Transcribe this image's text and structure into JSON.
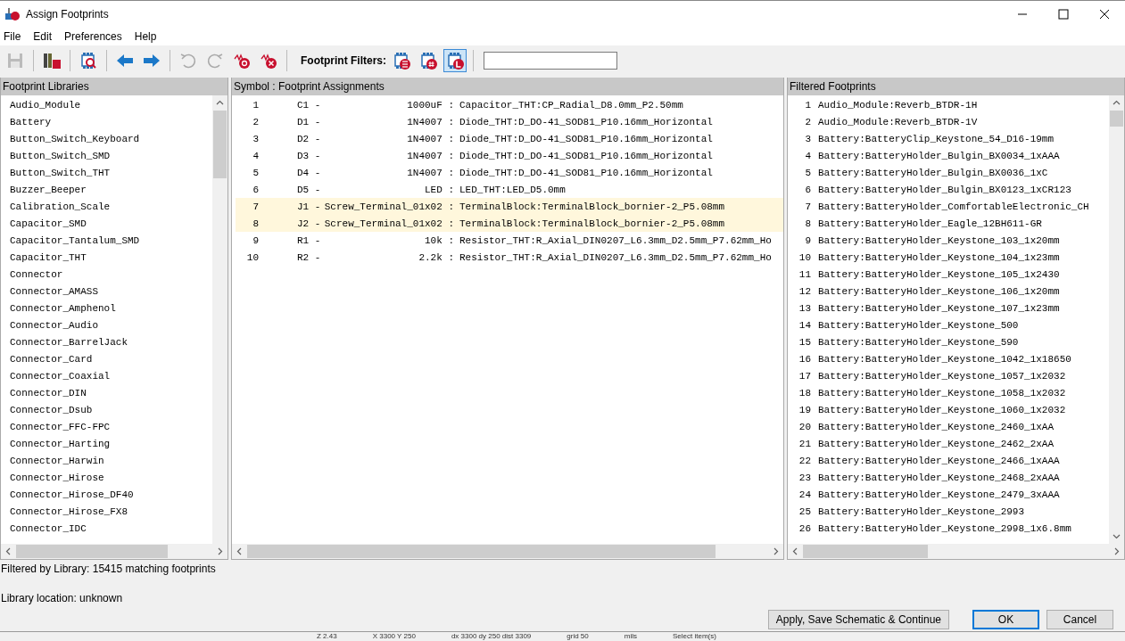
{
  "window": {
    "title": "Assign Footprints"
  },
  "menu": [
    "File",
    "Edit",
    "Preferences",
    "Help"
  ],
  "toolbar": {
    "filters_label": "Footprint Filters:",
    "filters": [
      {
        "kind": "list",
        "selected": false
      },
      {
        "kind": "pin",
        "selected": false
      },
      {
        "kind": "library",
        "selected": true
      }
    ]
  },
  "libraries": {
    "title": "Footprint Libraries",
    "items": [
      "Audio_Module",
      "Battery",
      "Button_Switch_Keyboard",
      "Button_Switch_SMD",
      "Button_Switch_THT",
      "Buzzer_Beeper",
      "Calibration_Scale",
      "Capacitor_SMD",
      "Capacitor_Tantalum_SMD",
      "Capacitor_THT",
      "Connector",
      "Connector_AMASS",
      "Connector_Amphenol",
      "Connector_Audio",
      "Connector_BarrelJack",
      "Connector_Card",
      "Connector_Coaxial",
      "Connector_DIN",
      "Connector_Dsub",
      "Connector_FFC-FPC",
      "Connector_Harting",
      "Connector_Harwin",
      "Connector_Hirose",
      "Connector_Hirose_DF40",
      "Connector_Hirose_FX8",
      "Connector_IDC"
    ]
  },
  "assignments": {
    "title": "Symbol : Footprint Assignments",
    "rows": [
      {
        "index": "1",
        "reference": "C1 -",
        "value": "1000uF :",
        "footprint": "Capacitor_THT:CP_Radial_D8.0mm_P2.50mm",
        "highlighted": false
      },
      {
        "index": "2",
        "reference": "D1 -",
        "value": "1N4007 :",
        "footprint": "Diode_THT:D_DO-41_SOD81_P10.16mm_Horizontal",
        "highlighted": false
      },
      {
        "index": "3",
        "reference": "D2 -",
        "value": "1N4007 :",
        "footprint": "Diode_THT:D_DO-41_SOD81_P10.16mm_Horizontal",
        "highlighted": false
      },
      {
        "index": "4",
        "reference": "D3 -",
        "value": "1N4007 :",
        "footprint": "Diode_THT:D_DO-41_SOD81_P10.16mm_Horizontal",
        "highlighted": false
      },
      {
        "index": "5",
        "reference": "D4 -",
        "value": "1N4007 :",
        "footprint": "Diode_THT:D_DO-41_SOD81_P10.16mm_Horizontal",
        "highlighted": false
      },
      {
        "index": "6",
        "reference": "D5 -",
        "value": "LED :",
        "footprint": "LED_THT:LED_D5.0mm",
        "highlighted": false
      },
      {
        "index": "7",
        "reference": "J1 -",
        "value": "Screw_Terminal_01x02 :",
        "footprint": "TerminalBlock:TerminalBlock_bornier-2_P5.08mm",
        "highlighted": true
      },
      {
        "index": "8",
        "reference": "J2 -",
        "value": "Screw_Terminal_01x02 :",
        "footprint": "TerminalBlock:TerminalBlock_bornier-2_P5.08mm",
        "highlighted": true
      },
      {
        "index": "9",
        "reference": "R1 -",
        "value": "10k :",
        "footprint": "Resistor_THT:R_Axial_DIN0207_L6.3mm_D2.5mm_P7.62mm_Ho",
        "highlighted": false
      },
      {
        "index": "10",
        "reference": "R2 -",
        "value": "2.2k :",
        "footprint": "Resistor_THT:R_Axial_DIN0207_L6.3mm_D2.5mm_P7.62mm_Ho",
        "highlighted": false
      }
    ]
  },
  "filtered": {
    "title": "Filtered Footprints",
    "items": [
      {
        "index": "1",
        "name": "Audio_Module:Reverb_BTDR-1H"
      },
      {
        "index": "2",
        "name": "Audio_Module:Reverb_BTDR-1V"
      },
      {
        "index": "3",
        "name": "Battery:BatteryClip_Keystone_54_D16-19mm"
      },
      {
        "index": "4",
        "name": "Battery:BatteryHolder_Bulgin_BX0034_1xAAA"
      },
      {
        "index": "5",
        "name": "Battery:BatteryHolder_Bulgin_BX0036_1xC"
      },
      {
        "index": "6",
        "name": "Battery:BatteryHolder_Bulgin_BX0123_1xCR123"
      },
      {
        "index": "7",
        "name": "Battery:BatteryHolder_ComfortableElectronic_CH"
      },
      {
        "index": "8",
        "name": "Battery:BatteryHolder_Eagle_12BH611-GR"
      },
      {
        "index": "9",
        "name": "Battery:BatteryHolder_Keystone_103_1x20mm"
      },
      {
        "index": "10",
        "name": "Battery:BatteryHolder_Keystone_104_1x23mm"
      },
      {
        "index": "11",
        "name": "Battery:BatteryHolder_Keystone_105_1x2430"
      },
      {
        "index": "12",
        "name": "Battery:BatteryHolder_Keystone_106_1x20mm"
      },
      {
        "index": "13",
        "name": "Battery:BatteryHolder_Keystone_107_1x23mm"
      },
      {
        "index": "14",
        "name": "Battery:BatteryHolder_Keystone_500"
      },
      {
        "index": "15",
        "name": "Battery:BatteryHolder_Keystone_590"
      },
      {
        "index": "16",
        "name": "Battery:BatteryHolder_Keystone_1042_1x18650"
      },
      {
        "index": "17",
        "name": "Battery:BatteryHolder_Keystone_1057_1x2032"
      },
      {
        "index": "18",
        "name": "Battery:BatteryHolder_Keystone_1058_1x2032"
      },
      {
        "index": "19",
        "name": "Battery:BatteryHolder_Keystone_1060_1x2032"
      },
      {
        "index": "20",
        "name": "Battery:BatteryHolder_Keystone_2460_1xAA"
      },
      {
        "index": "21",
        "name": "Battery:BatteryHolder_Keystone_2462_2xAA"
      },
      {
        "index": "22",
        "name": "Battery:BatteryHolder_Keystone_2466_1xAAA"
      },
      {
        "index": "23",
        "name": "Battery:BatteryHolder_Keystone_2468_2xAAA"
      },
      {
        "index": "24",
        "name": "Battery:BatteryHolder_Keystone_2479_3xAAA"
      },
      {
        "index": "25",
        "name": "Battery:BatteryHolder_Keystone_2993"
      },
      {
        "index": "26",
        "name": "Battery:BatteryHolder_Keystone_2998_1x6.8mm"
      }
    ]
  },
  "status": {
    "filter_info": "Filtered by Library: 15415 matching footprints",
    "library_location": "Library location: unknown"
  },
  "buttons": [
    {
      "label": "Apply, Save Schematic & Continue",
      "kind": "normal"
    },
    {
      "label": "OK",
      "kind": "default"
    },
    {
      "label": "Cancel",
      "kind": "normal"
    }
  ],
  "background_status_bar": [
    "Z 2.43",
    "X 3300  Y 250",
    "dx 3300  dy 250  dist 3309",
    "grid 50",
    "mils",
    "Select item(s)"
  ]
}
